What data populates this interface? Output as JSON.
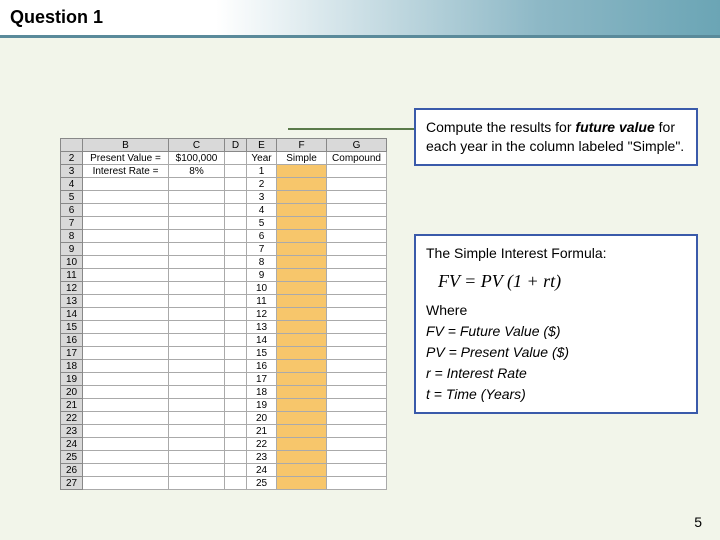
{
  "header": {
    "title": "Question 1"
  },
  "spreadsheet": {
    "cols": [
      "B",
      "C",
      "D",
      "E",
      "F",
      "G"
    ],
    "row_start": 2,
    "row_end": 27,
    "labels": {
      "present_value_label": "Present Value =",
      "present_value": "$100,000",
      "interest_rate_label": "Interest Rate =",
      "interest_rate": "8%",
      "year_col": "Year",
      "simple_col": "Simple",
      "compound_col": "Compound"
    },
    "years": [
      1,
      2,
      3,
      4,
      5,
      6,
      7,
      8,
      9,
      10,
      11,
      12,
      13,
      14,
      15,
      16,
      17,
      18,
      19,
      20,
      21,
      22,
      23,
      24,
      25
    ]
  },
  "callout1": {
    "line1_pre": "Compute the results for ",
    "line1_em": "future value",
    "line1_post": " for each year in the column labeled \"Simple\"."
  },
  "callout2": {
    "title": "The Simple Interest Formula:",
    "formula": "FV = PV (1 + rt)",
    "where": "Where",
    "defs": [
      "FV = Future Value ($)",
      "PV = Present Value ($)",
      "r = Interest Rate",
      "t = Time (Years)"
    ]
  },
  "page_number": "5"
}
